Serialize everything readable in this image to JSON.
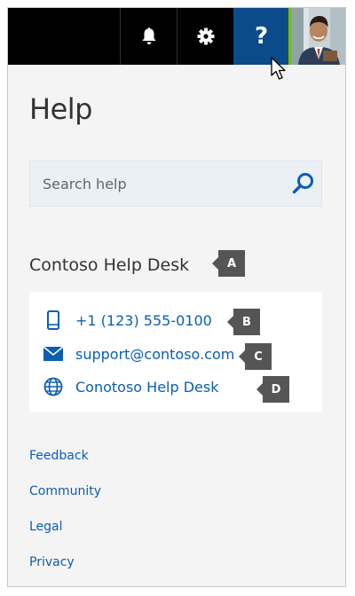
{
  "topbar": {
    "notifications_icon": "bell-icon",
    "settings_icon": "gear-icon",
    "help_label": "?",
    "avatar_icon": "user-avatar"
  },
  "panel": {
    "title": "Help",
    "search": {
      "placeholder": "Search help",
      "icon": "search-icon"
    }
  },
  "helpdesk": {
    "title": "Contoso Help Desk",
    "tag_title": "A",
    "items": [
      {
        "icon": "phone-icon",
        "label": "+1 (123) 555-0100",
        "tag": "B"
      },
      {
        "icon": "mail-icon",
        "label": "support@contoso.com",
        "tag": "C"
      },
      {
        "icon": "globe-icon",
        "label": "Conotoso Help Desk",
        "tag": "D"
      }
    ]
  },
  "footer": {
    "links": [
      "Feedback",
      "Community",
      "Legal",
      "Privacy"
    ]
  },
  "colors": {
    "topbar": "#000000",
    "help_active": "#0b4a8b",
    "link": "#0b5fb3",
    "tag_bg": "#555555",
    "avatar_border": "#7fba00"
  }
}
